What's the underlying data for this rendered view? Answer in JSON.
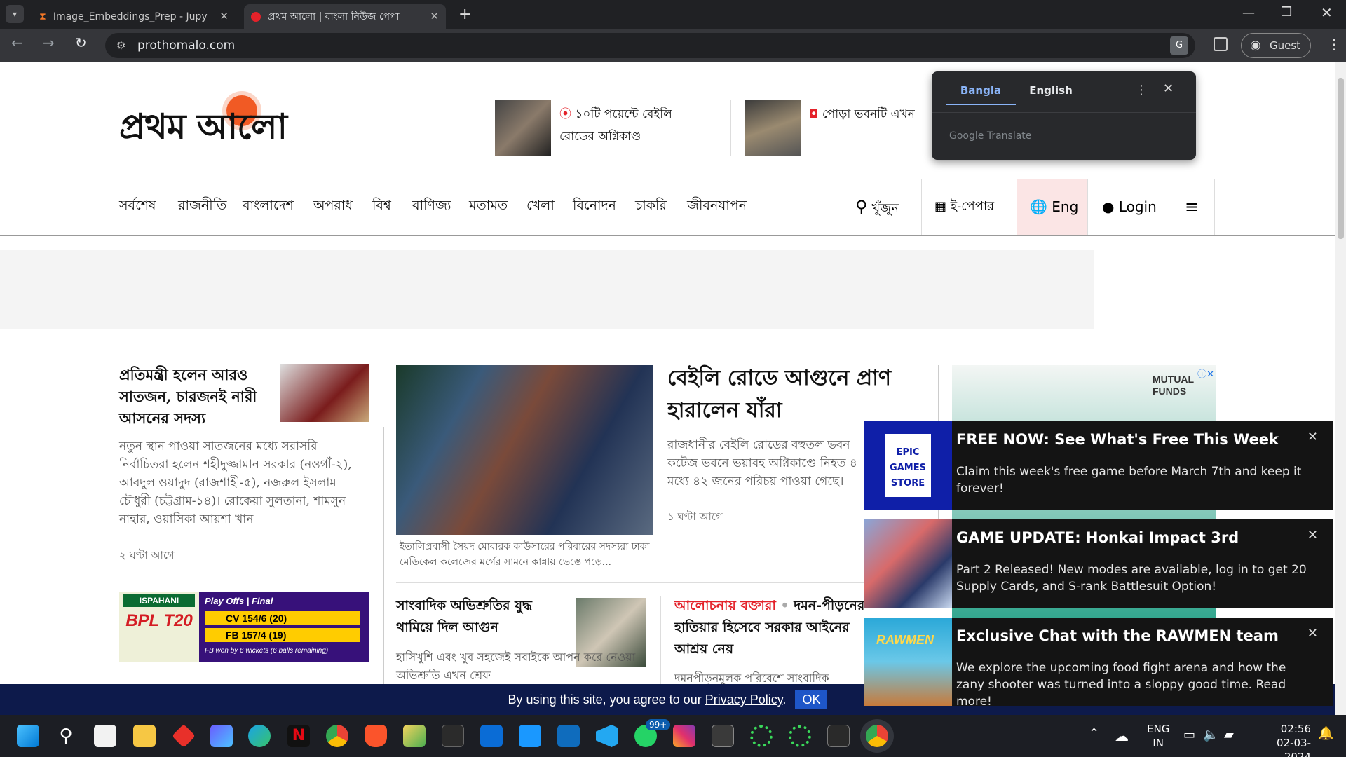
{
  "browser": {
    "tabs": [
      {
        "title": "Image_Embeddings_Prep - Jupy",
        "active": false
      },
      {
        "title": "প্রথম আলো | বাংলা নিউজ পেপা",
        "active": true
      }
    ],
    "url": "prothomalo.com",
    "profile": "Guest"
  },
  "translate_popup": {
    "tab_bangla": "Bangla",
    "tab_english": "English",
    "footer": "Google Translate"
  },
  "site": {
    "logo": "প্রথম আলো",
    "header_stories": [
      {
        "text": "১০টি পয়েন্টে বেইলি রোডের অগ্নিকাণ্ড"
      },
      {
        "text": "পোড়া ভবনটি এখন"
      }
    ],
    "nav": [
      "সর্বশেষ",
      "রাজনীতি",
      "বাংলাদেশ",
      "অপরাধ",
      "বিশ্ব",
      "বাণিজ্য",
      "মতামত",
      "খেলা",
      "বিনোদন",
      "চাকরি",
      "জীবনযাপন"
    ],
    "tools": {
      "search": "খুঁজুন",
      "epaper": "ই-পেপার",
      "lang": "Eng",
      "login": "Login"
    },
    "story_left": {
      "headline": "প্রতিমন্ত্রী হলেন আরও সাতজন, চারজনই নারী আসনের সদস্য",
      "summary": "নতুন স্থান পাওয়া সাতজনের মধ্যে সরাসরি নির্বাচিতরা হলেন শহীদুজ্জামান সরকার (নওগাঁ-২), আবদুল ওয়াদুদ (রাজশাহী-৫), নজরুল ইসলাম চৌধুরী (চট্টগ্রাম-১৪)। রোকেয়া সুলতানা, শামসুন নাহার, ওয়াসিকা আয়শা খান",
      "time": "২ ঘণ্টা আগে"
    },
    "score": {
      "title": "Play Offs | Final",
      "team1": "CV 154/6 (20)",
      "team2": "FB 157/4 (19)",
      "result": "FB won by 6 wickets (6 balls remaining)",
      "sponsor": "ISPAHANI",
      "league": "BPL T20"
    },
    "lead": {
      "headline": "বেইলি রোডে আগুনে প্রাণ হারালেন যাঁরা",
      "summary": "রাজধানীর বেইলি রোডের বহুতল ভবন কটেজ ভবনে ভয়াবহ অগ্নিকাণ্ডে নিহত ৪ মধ্যে ৪২ জনের পরিচয় পাওয়া গেছে।",
      "time": "১ ঘণ্টা আগে",
      "caption": "ইতালিপ্রবাসী সৈয়দ মোবারক কাউসারের পরিবারের সদস্যরা ঢাকা মেডিকেল কলেজের মর্গের সামনে কান্নায় ভেঙে পড়ে..."
    },
    "story2": {
      "headline": "সাংবাদিক অভিশ্রুতির যুদ্ধ থামিয়ে দিল আগুন",
      "summary": "হাসিখুশি এবং খুব সহজেই সবাইকে আপন করে নেওয়া অভিশ্রুতি এখন শ্রেফ"
    },
    "story3": {
      "kicker": "আলোচনায় বক্তারা",
      "headline": "দমন-পীড়নের হাতিয়ার হিসেবে সরকার আইনের আশ্রয় নেয়",
      "summary": "দমনপীড়নমূলক পরিবেশে সাংবাদিক"
    },
    "ad_text": "MUTUAL FUNDS",
    "cookie": {
      "text": "By using this site, you agree to our",
      "link": "Privacy Policy",
      "ok": "OK"
    }
  },
  "notifications": [
    {
      "title": "FREE NOW: See What's Free This Week",
      "desc": "Claim this week's free game before March 7th and keep it forever!",
      "logo": "EPIC GAMES STORE"
    },
    {
      "title": "GAME UPDATE: Honkai Impact 3rd",
      "desc": "Part 2 Released! New modes are available, log in to get 20 Supply Cards, and S-rank Battlesuit Option!"
    },
    {
      "title": "Exclusive Chat with the RAWMEN team",
      "desc": "We explore the upcoming food fight arena and how the zany shooter was turned into a sloppy good time. Read more!",
      "logo": "RAWMEN"
    }
  ],
  "taskbar": {
    "lang": "ENG",
    "region": "IN",
    "time": "02:56",
    "date": "02-03-2024",
    "whatsapp_badge": "99+"
  },
  "colors": {
    "brand_red": "#e4222a",
    "notif_bg": "#141414",
    "cookie_bg": "#0d1a4b"
  }
}
